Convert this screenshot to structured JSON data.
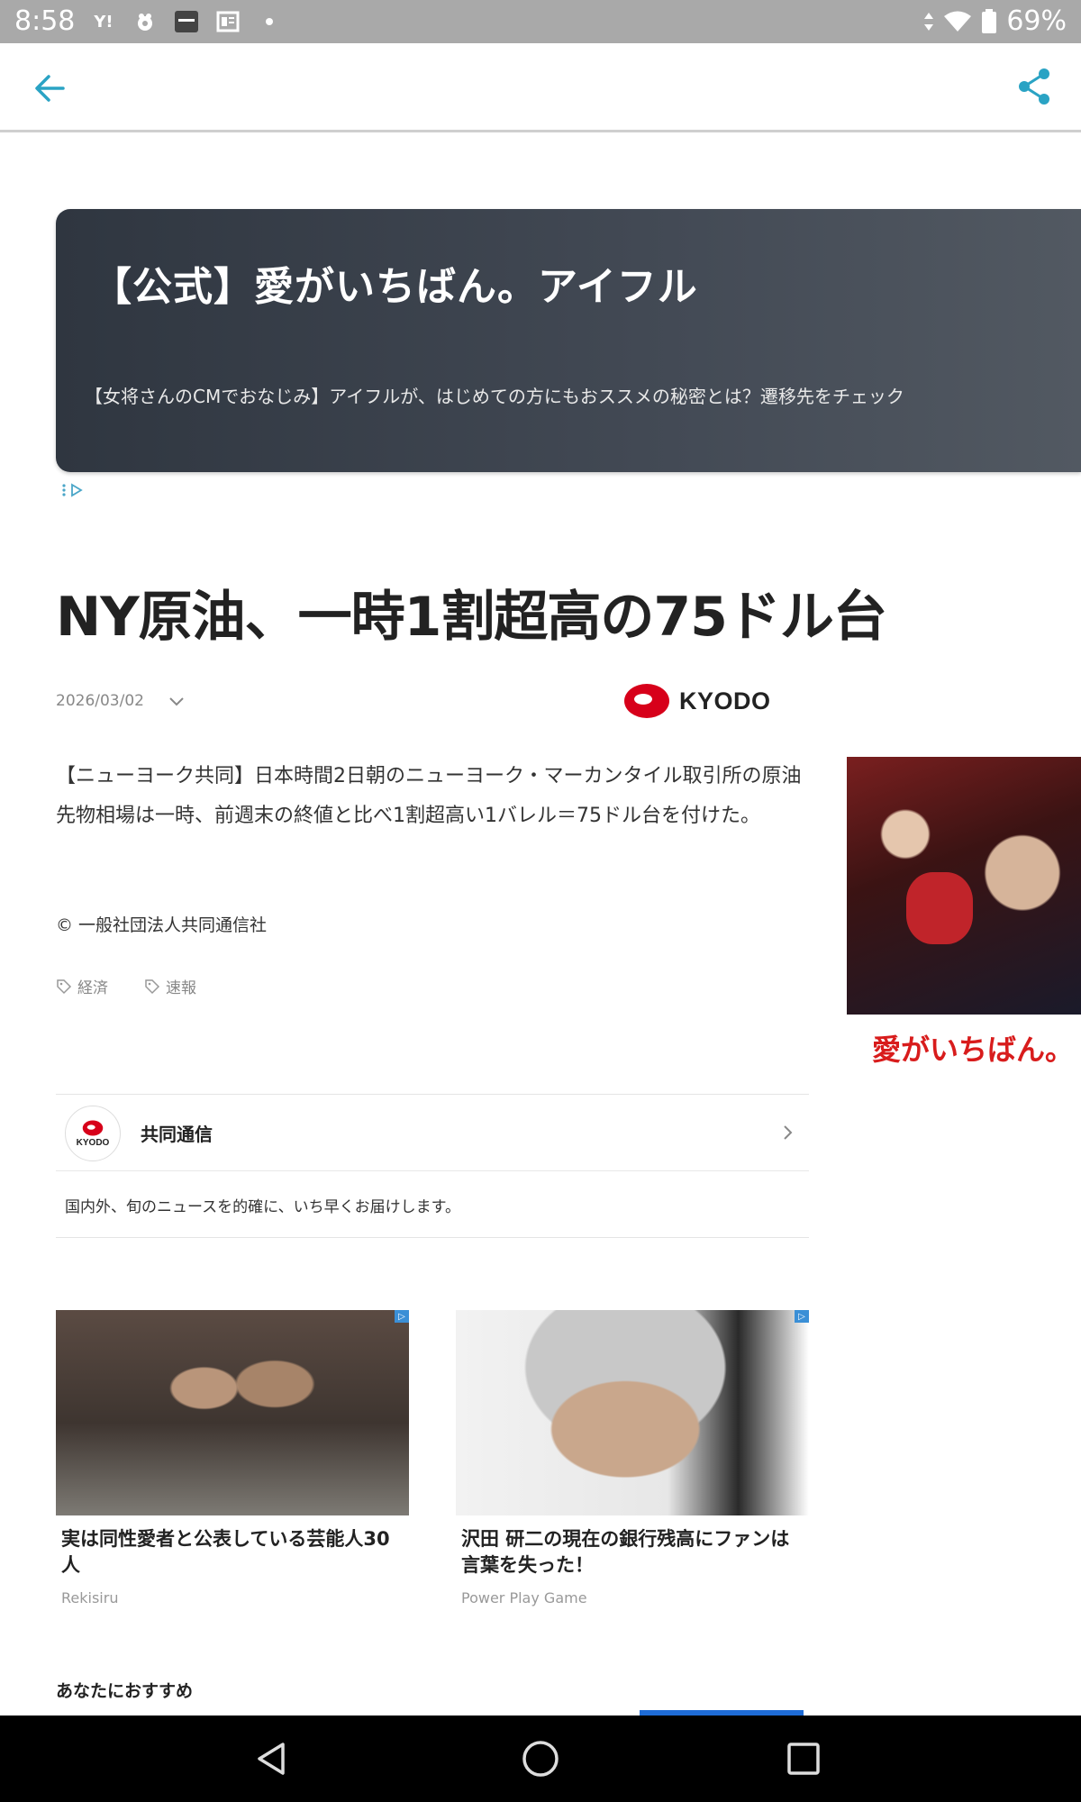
{
  "status_bar": {
    "time": "8:58",
    "battery": "69%",
    "icons": [
      "yahoo-icon",
      "app-icon",
      "news-app-icon",
      "newspaper-icon",
      "dot-icon"
    ]
  },
  "ad_banner": {
    "title": "【公式】愛がいちばん。アイフル",
    "description": "【女将さんのCMでおなじみ】アイフルが、はじめての方にもおススメの秘密とは？遷移先をチェック"
  },
  "article": {
    "headline": "NY原油、一時1割超高の75ドル台",
    "date": "2026/03/02",
    "publisher_logo": "KYODO",
    "body": "【ニューヨーク共同】日本時間2日朝のニューヨーク・マーカンタイル取引所の原油先物相場は一時、前週末の終値と比べ1割超高い1バレル＝75ドル台を付けた。",
    "copyright": "© 一般社団法人共同通信社",
    "tags": [
      "経済",
      "速報"
    ]
  },
  "side_ad": {
    "caption": "愛がいちばん。"
  },
  "publisher_card": {
    "avatar_text": "KYODO",
    "name": "共同通信",
    "description": "国内外、旬のニュースを的確に、いち早くお届けします。"
  },
  "recommended_cards": [
    {
      "title": "実は同性愛者と公表している芸能人30人",
      "source": "Rekisiru"
    },
    {
      "title": "沢田 研二の現在の銀行残高にファンは言葉を失った！",
      "source": "Power Play Game"
    }
  ],
  "recommendations_heading": "あなたにおすすめ",
  "colors": {
    "accent": "#2aa3c4",
    "kyodo_red": "#d7001a",
    "ad_bg": "#3a4049"
  }
}
